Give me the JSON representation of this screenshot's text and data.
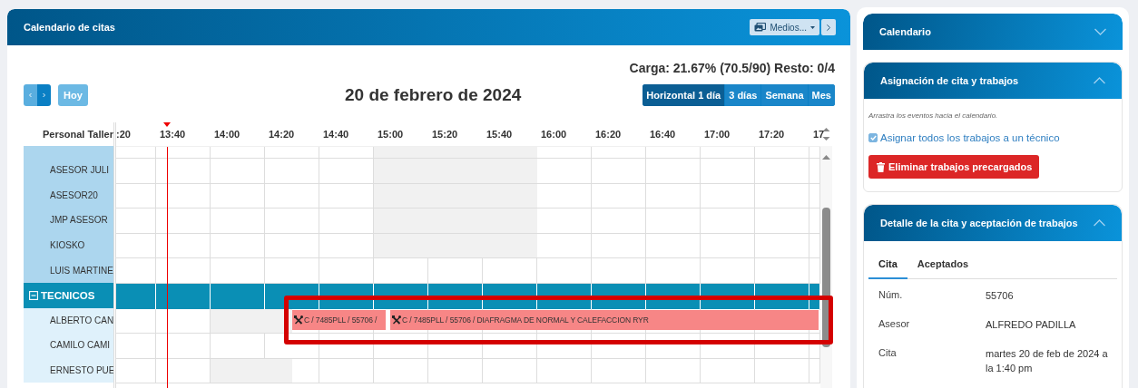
{
  "calendar_panel": {
    "title": "Calendario de citas",
    "media_button": "Medios...",
    "load_summary": "Carga: 21.67% (70.5/90) Resto: 0/4",
    "today_button": {
      "label": "Hoy",
      "disabled": true
    },
    "date_title": "20 de febrero de 2024",
    "views": [
      {
        "label": "Horizontal 1 día",
        "selected": true
      },
      {
        "label": "3 días",
        "selected": false
      },
      {
        "label": "Semana",
        "selected": false
      },
      {
        "label": "Mes",
        "selected": false
      }
    ],
    "resource_header": "Personal Taller",
    "time_slots": [
      ":20",
      "13:40",
      "14:00",
      "14:20",
      "14:40",
      "15:00",
      "15:20",
      "15:40",
      "16:00",
      "16:20",
      "16:40",
      "17:00",
      "17:20",
      "17"
    ],
    "resources": [
      {
        "kind": "resource-cut"
      },
      {
        "kind": "resource",
        "name": "ASESOR JULI"
      },
      {
        "kind": "resource",
        "name": "ASESOR20"
      },
      {
        "kind": "resource",
        "name": "JMP ASESOR"
      },
      {
        "kind": "resource",
        "name": "KIOSKO"
      },
      {
        "kind": "resource",
        "name": "LUIS MARTINE"
      },
      {
        "kind": "group",
        "name": "TECNICOS",
        "expanded": true,
        "children": [
          {
            "kind": "resource",
            "name": "ALBERTO CAN",
            "highlighted": true,
            "events": [
              {
                "text": "C / 7485PLL / 55706 /"
              },
              {
                "text": "C / 7485PLL / 55706 / DIAFRAGMA DE NORMAL Y CALEFACCION RYR"
              }
            ]
          },
          {
            "kind": "resource",
            "name": "CAMILO CAMI"
          },
          {
            "kind": "resource",
            "name": "ERNESTO PUE"
          }
        ]
      }
    ]
  },
  "sidebar": {
    "sections": [
      {
        "kind": "plain",
        "title": "Calendario",
        "expanded": false
      },
      {
        "kind": "assign",
        "title": "Asignación de cita y trabajos",
        "expanded": true,
        "hint": "Arrastra los eventos hacia el calendario.",
        "checkbox": {
          "label": "Asignar todos los trabajos a un técnico",
          "checked": true
        },
        "button": "Eliminar trabajos precargados"
      },
      {
        "kind": "detail",
        "title": "Detalle de la cita y aceptación de trabajos",
        "expanded": true,
        "tabs": [
          {
            "label": "Cita",
            "selected": true
          },
          {
            "label": "Aceptados",
            "selected": false
          }
        ],
        "fields": [
          {
            "label": "Núm.",
            "value": "55706"
          },
          {
            "label": "Asesor",
            "value": "ALFREDO PADILLA"
          },
          {
            "label": "Cita",
            "value": "martes 20 de feb de 2024 a la 1:40 pm"
          }
        ]
      }
    ]
  }
}
